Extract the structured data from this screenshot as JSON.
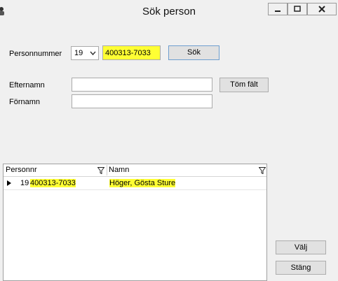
{
  "window": {
    "title": "Sök person"
  },
  "form": {
    "personnummer_label": "Personnummer",
    "century_value": "19",
    "personnummer_value": "400313-7033",
    "search_button": "Sök",
    "efternamn_label": "Efternamn",
    "efternamn_value": "",
    "fornamn_label": "Förnamn",
    "fornamn_value": "",
    "clear_button": "Töm fält"
  },
  "results": {
    "columns": [
      "Personnr",
      "Namn"
    ],
    "rows": [
      {
        "century": "19",
        "personnr": "400313-7033",
        "namn": "Höger, Gösta Sture"
      }
    ]
  },
  "actions": {
    "choose_button": "Välj",
    "close_button": "Stäng"
  },
  "colors": {
    "highlight": "#ffff33",
    "window_bg": "#f0f0f0"
  }
}
